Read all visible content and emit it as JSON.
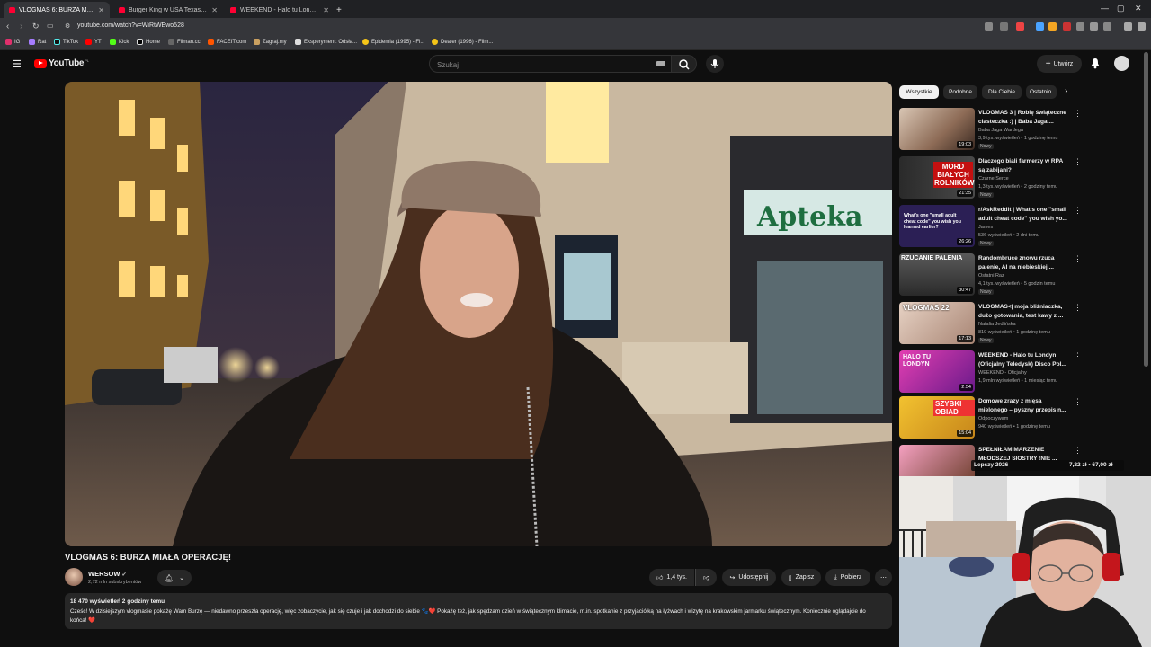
{
  "browser": {
    "tabs": [
      {
        "label": "VLOGMAS 6: BURZA MIAŁA OPE",
        "active": true
      },
      {
        "label": "Burger King w USA Texas 69 - YouTu",
        "active": false
      },
      {
        "label": "WEEKEND - Halo tu Londyn (Oficjaln",
        "active": false
      }
    ],
    "url": "youtube.com/watch?v=WiRtWEwo528",
    "bookmarks": [
      "IG",
      "Rat",
      "TikTok",
      "YT",
      "Kick",
      "Home",
      "Filman.cc",
      "FACEIT.com",
      "Zagraj.my",
      "Eksperyment: Odsła...",
      "Epidemia (1995) - Fi...",
      "Dealer (1996) - Film..."
    ]
  },
  "header": {
    "logo_text": "YouTube",
    "logo_country": "PL",
    "search_placeholder": "Szukaj",
    "create_label": "Utwórz"
  },
  "video": {
    "title": "VLOGMAS 6: BURZA MIAŁA OPERACJĘ!",
    "storefront_sign": "Apteka",
    "channel": {
      "name": "WERSOW",
      "subscribers": "2,72 mln subskrybentów"
    },
    "actions": {
      "likes": "1,4 tys.",
      "share": "Udostępnij",
      "save": "Zapisz",
      "download": "Pobierz"
    },
    "description": {
      "meta": "18 470 wyświetleń  2 godziny temu",
      "text": "Cześć! W dzisiejszym vlogmasie pokażę Wam Burzę — niedawno przeszła operację, więc zobaczycie, jak się czuje i jak dochodzi do siebie 🐾❤️ Pokażę też, jak spędzam dzień w świątecznym klimacie, m.in. spotkanie z przyjaciółką na łyżwach i wizytę na krakowskim jarmarku świątecznym. Koniecznie oglądajcie do końca! ❤️"
    }
  },
  "sidebar": {
    "chips": [
      {
        "label": "Wszystkie",
        "active": true
      },
      {
        "label": "Podobne",
        "active": false
      },
      {
        "label": "Dla Ciebie",
        "active": false
      },
      {
        "label": "Ostatnio",
        "active": false
      }
    ],
    "recommendations": [
      {
        "title": "VLOGMAS 3 | Robię świąteczne ciasteczka :) | Baba Jaga ...",
        "channel": "Baba Jaga Wardega",
        "views": "3,9 tys. wyświetleń • 1 godzinę temu",
        "duration": "19:03",
        "badge": "Nowy",
        "thumb_text": ""
      },
      {
        "title": "Dlaczego biali farmerzy w RPA są zabijani?",
        "channel": "Czarne Serce",
        "views": "1,3 tys. wyświetleń • 2 godziny temu",
        "duration": "21:35",
        "badge": "Nowy",
        "thumb_text": "MORD BIAŁYCH ROLNIKÓW"
      },
      {
        "title": "r/AskReddit | What's one \"small adult cheat code\" you wish yo...",
        "channel": "James",
        "views": "536 wyświetleń • 2 dni temu",
        "duration": "26:26",
        "badge": "Nowy",
        "thumb_text": "What's one \"small adult cheat code\" you wish you learned earlier?"
      },
      {
        "title": "Randombruce znowu rzuca palenie, AI na niebieskiej ...",
        "channel": "Ostatni Raz",
        "views": "4,1 tys. wyświetleń • 5 godzin temu",
        "duration": "30:47",
        "badge": "Nowy",
        "thumb_text": "RZUCANIE PALENIA"
      },
      {
        "title": "VLOGMAS<| moja bliźniaczka, dużo gotowania, test kawy z ...",
        "channel": "Natalia Jedlińska",
        "views": "819 wyświetleń • 1 godzinę temu",
        "duration": "17:13",
        "badge": "Nowy",
        "thumb_text": "VLOGMAS 22"
      },
      {
        "title": "WEEKEND - Halo tu Londyn (Oficjalny Teledysk) Disco Pol...",
        "channel": "WEEKEND - Oficjalny",
        "views": "1,9 mln wyświetleń • 1 miesiąc temu",
        "duration": "2:54",
        "badge": "",
        "thumb_text": "HALO TU LONDYN"
      },
      {
        "title": "Domowe zrazy z mięsa mielonego – pyszny przepis n...",
        "channel": "Odpoczywam",
        "views": "940 wyświetleń • 1 godzinę temu",
        "duration": "15:04",
        "badge": "",
        "thumb_text": "SZYBKI OBIAD"
      },
      {
        "title": "SPEŁNIŁAM MARZENIE MŁODSZEJ SIOSTRY !NIE ...",
        "channel": "",
        "views": "",
        "duration": "",
        "badge": "",
        "thumb_text": ""
      }
    ]
  },
  "overlay": {
    "goal_label": "Lepszy 2026",
    "goal_value": "7,22 zł • 67,00 zł"
  }
}
